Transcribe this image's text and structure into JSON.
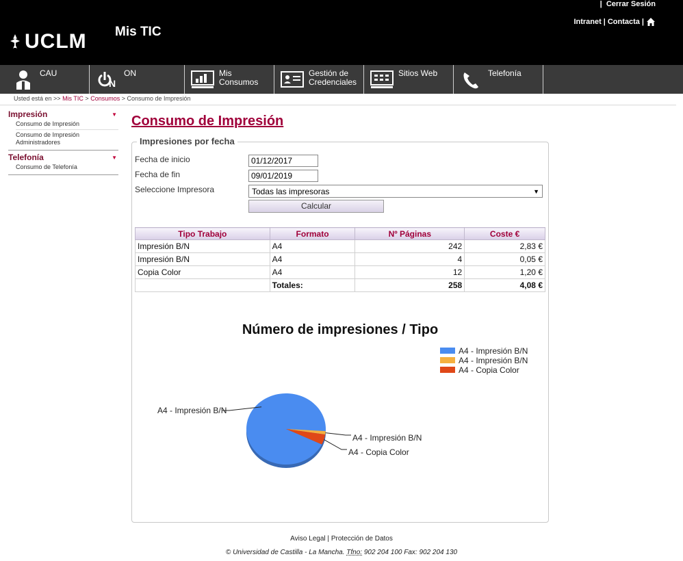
{
  "header": {
    "logo_text": "UCLM",
    "app_title": "Mis TIC",
    "cerrar_prefix": "|",
    "cerrar_sesion": "Cerrar Sesión",
    "intranet": "Intranet",
    "sep1": "|",
    "contacta": "Contacta",
    "sep2": "|"
  },
  "nav": {
    "items": [
      {
        "label": "CAU",
        "icon": "person-icon"
      },
      {
        "label": "ON",
        "icon": "power-on-icon"
      },
      {
        "label": "Mis Consumos",
        "icon": "monitor-chart-icon"
      },
      {
        "label": "Gestión de Credenciales",
        "icon": "id-card-icon"
      },
      {
        "label": "Sitios Web",
        "icon": "browser-window-icon"
      },
      {
        "label": "Telefonía",
        "icon": "phone-icon"
      }
    ]
  },
  "breadcrumb": {
    "prefix": "Usted está en >>",
    "crumb1": "Mis TIC",
    "sep": ">",
    "crumb2": "Consumos",
    "current": "> Consumo de Impresión"
  },
  "sidebar": {
    "sections": [
      {
        "title": "Impresión",
        "links": [
          "Consumo de Impresión",
          "Consumo de Impresión Administradores"
        ]
      },
      {
        "title": "Telefonía",
        "links": [
          "Consumo de Telefonía"
        ]
      }
    ]
  },
  "main": {
    "page_title": "Consumo de Impresión",
    "fieldset_title": "Impresiones por fecha",
    "fecha_inicio_label": "Fecha de inicio",
    "fecha_inicio_value": "01/12/2017",
    "fecha_fin_label": "Fecha de fin",
    "fecha_fin_value": "09/01/2019",
    "impresora_label": "Seleccione Impresora",
    "impresora_value": "Todas las impresoras",
    "calcular_label": "Calcular"
  },
  "table": {
    "headers": [
      "Tipo Trabajo",
      "Formato",
      "Nº Páginas",
      "Coste €"
    ],
    "rows": [
      {
        "tipo": "Impresión B/N",
        "formato": "A4",
        "paginas": "242",
        "coste": "2,83 €"
      },
      {
        "tipo": "Impresión B/N",
        "formato": "A4",
        "paginas": "4",
        "coste": "0,05 €"
      },
      {
        "tipo": "Copia Color",
        "formato": "A4",
        "paginas": "12",
        "coste": "1,20 €"
      }
    ],
    "totals_label": "Totales:",
    "totals_paginas": "258",
    "totals_coste": "4,08 €"
  },
  "chart_data": {
    "type": "pie",
    "title": "Número de impresiones / Tipo",
    "slices": [
      {
        "label": "A4 - Impresión B/N",
        "value": 242,
        "color": "#4a8cf0"
      },
      {
        "label": "A4 - Impresión B/N",
        "value": 4,
        "color": "#f5b040"
      },
      {
        "label": "A4 - Copia Color",
        "value": 12,
        "color": "#e04818"
      }
    ],
    "legend_position": "top-right"
  },
  "footer": {
    "aviso_legal": "Aviso Legal",
    "sep": "|",
    "proteccion": "Protección de Datos",
    "copyright": "© Universidad de Castilla - La Mancha.",
    "tfno_label": "Tfno:",
    "contact_numbers": "902 204 100 Fax: 902 204 130"
  }
}
